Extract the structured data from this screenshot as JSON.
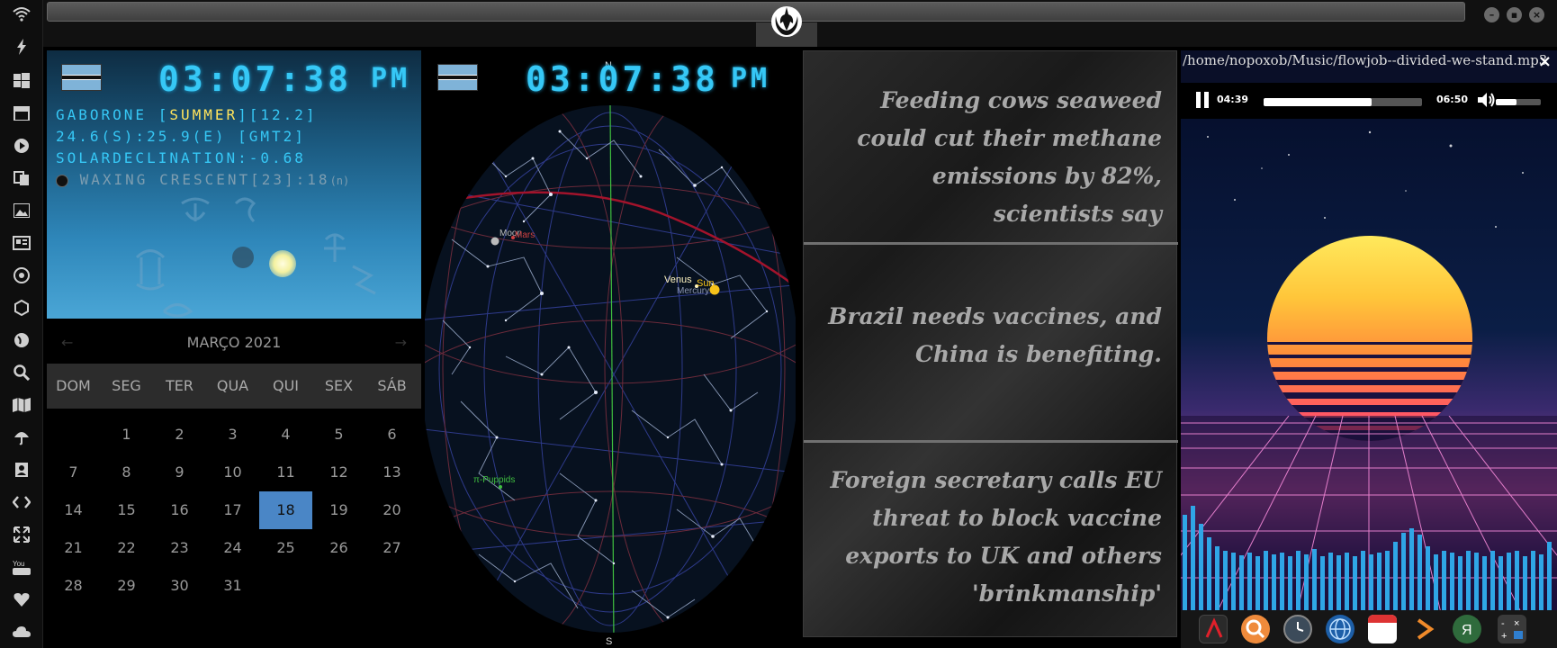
{
  "sidebar": {
    "icons": [
      "wifi-icon",
      "lightning-icon",
      "windows-icon",
      "archive-icon",
      "play-icon",
      "translate-icon",
      "image-icon",
      "news-icon",
      "settings-icon",
      "hexagon-icon",
      "globe-icon",
      "search-icon",
      "map-icon",
      "umbrella-icon",
      "contact-icon",
      "code-icon",
      "expand-icon",
      "youtube-icon",
      "heart-icon",
      "cloud-icon"
    ]
  },
  "clock_a": {
    "time": "03:07:38",
    "ampm": "PM",
    "line1_prefix": "GABORONE [",
    "line1_season": "SUMMER",
    "line1_suffix": "][12.2]",
    "line2": "24.6(S):25.9(E) [GMT2]",
    "line3": "SOLARDECLINATION:-0.68",
    "line4": "WAXING CRESCENT[23]:18",
    "line4_small": "(n)"
  },
  "clock_b": {
    "time": "03:07:38",
    "ampm": "PM"
  },
  "calendar": {
    "month_label": "MARÇO 2021",
    "prev": "←",
    "next": "→",
    "dows": [
      "DOM",
      "SEG",
      "TER",
      "QUA",
      "QUI",
      "SEX",
      "SÁB"
    ],
    "today": "18",
    "weeks": [
      [
        "",
        "1",
        "2",
        "3",
        "4",
        "5",
        "6"
      ],
      [
        "7",
        "8",
        "9",
        "10",
        "11",
        "12",
        "13"
      ],
      [
        "14",
        "15",
        "16",
        "17",
        "18",
        "19",
        "20"
      ],
      [
        "21",
        "22",
        "23",
        "24",
        "25",
        "26",
        "27"
      ],
      [
        "28",
        "29",
        "30",
        "31",
        "",
        "",
        ""
      ]
    ]
  },
  "sky": {
    "north": "N",
    "south": "S",
    "labels": {
      "moon": "Moon",
      "mars": "Mars",
      "venus": "Venus",
      "sun": "Sun",
      "mercury": "Mercury",
      "star": "π-Puppids"
    }
  },
  "news": {
    "items": [
      "Feeding cows seaweed could cut their methane emissions by 82%, scientists say",
      "Brazil needs vaccines, and China is benefiting.",
      "Foreign secretary calls EU threat to block vaccine exports to UK and others 'brinkmanship'"
    ]
  },
  "player": {
    "path": "/home/nopoxob/Music/flowjob--divided-we-stand.mp3",
    "close": "×",
    "elapsed": "04:39",
    "total": "06:50",
    "progress": 0.68,
    "volume": 0.45
  },
  "colors": {
    "digital": "#36c8f6",
    "highlight": "#ffe45c",
    "today": "#4a86c6"
  }
}
